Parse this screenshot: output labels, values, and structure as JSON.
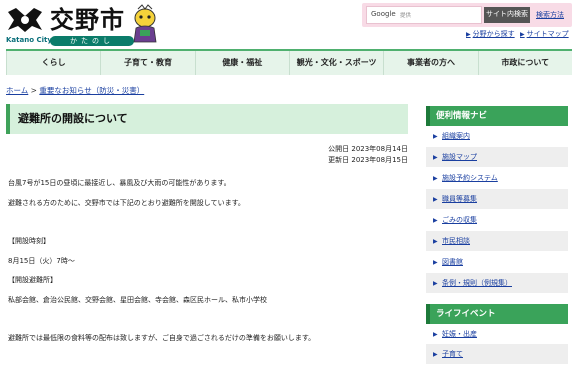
{
  "header": {
    "logo_title": "交野市",
    "logo_en": "Katano City",
    "logo_jp": "かたのし",
    "search_placeholder": "Google",
    "search_ph_small": "提供",
    "search_button": "サイト内検索",
    "search_help": "検索方法",
    "util_links": [
      "分野から探す",
      "サイトマップ"
    ]
  },
  "nav": {
    "items": [
      "くらし",
      "子育て・教育",
      "健康・福祉",
      "観光・文化・スポーツ",
      "事業者の方へ",
      "市政について"
    ]
  },
  "breadcrumb": {
    "home": "ホーム",
    "separator": " > ",
    "current": "重要なお知らせ（防災・災害）"
  },
  "main": {
    "title": "避難所の開設について",
    "published": "公開日 2023年08月14日",
    "updated": "更新日 2023年08月15日",
    "paragraphs": [
      "台風7号が15日の昼頃に最接近し、暴風及び大雨の可能性があります。",
      "避難される方のために、交野市では下記のとおり避難所を開設しています。",
      "【開設時刻】",
      "8月15日（火）7時〜",
      "【開設避難所】",
      "私部会館、倉治公民館、交野会館、星田会館、寺会館、森区民ホール、私市小学校",
      "避難所では最低限の食料等の配布は致しますが、ご自身で過ごされるだけの準備をお願いします。"
    ]
  },
  "sidebar": {
    "nav_heading": "便利情報ナビ",
    "nav_items": [
      "組織案内",
      "施設マップ",
      "施設予約システム",
      "職員等募集",
      "ごみの収集",
      "市民相談",
      "図書館",
      "条例・規則（例規集）"
    ],
    "life_heading": "ライフイベント",
    "life_items": [
      "妊娠・出産",
      "子育て"
    ]
  },
  "colors": {
    "accent_green": "#3aa35a",
    "nav_bg": "#e6f4ea",
    "title_bg": "#d6f0dc",
    "link": "#1a3fa0",
    "search_frame": "#f8dbe6"
  }
}
